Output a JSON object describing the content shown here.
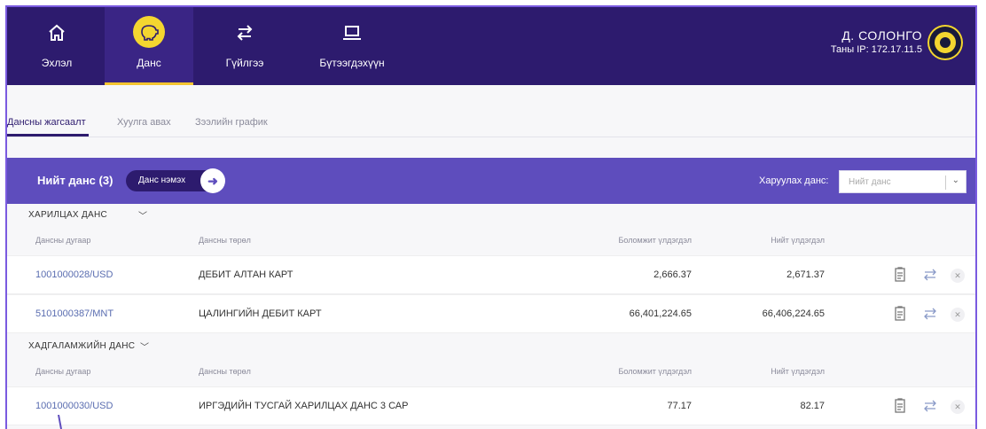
{
  "nav": {
    "items": [
      {
        "label": "Эхлэл",
        "icon": "home-icon"
      },
      {
        "label": "Данс",
        "icon": "piggy-bank-icon"
      },
      {
        "label": "Гүйлгээ",
        "icon": "transfer-icon"
      },
      {
        "label": "Бүтээгдэхүүн",
        "icon": "laptop-icon"
      }
    ],
    "active_index": 1,
    "accent": "#f4c430"
  },
  "user": {
    "name": "Д. СОЛОНГО",
    "ip": "Таны IP: 172.17.11.5"
  },
  "subtabs": [
    {
      "label": "Дансны жагсаалт",
      "active": true
    },
    {
      "label": "Хуулга авах",
      "active": false
    },
    {
      "label": "Зээлийн график",
      "active": false
    }
  ],
  "account_bar": {
    "total_label": "Нийт данс (3)",
    "add_label": "Данс нэмэх",
    "show_label": "Харуулах данс:",
    "select_placeholder": "Нийт данс",
    "color": "#5e4dbd"
  },
  "columns": {
    "account": "Дансны дугаар",
    "type": "Дансны төрөл",
    "available": "Боломжит үлдэгдэл",
    "total": "Нийт үлдэгдэл"
  },
  "sections": [
    {
      "title": "ХАРИЛЦАХ ДАНС",
      "rows": [
        {
          "account": "1001000028/USD",
          "type": "ДЕБИТ АЛТАН КАРТ",
          "available": "2,666.37",
          "total": "2,671.37"
        },
        {
          "account": "5101000387/MNT",
          "type": "ЦАЛИНГИЙН ДЕБИТ КАРТ",
          "available": "66,401,224.65",
          "total": "66,406,224.65"
        }
      ]
    },
    {
      "title": "ХАДГАЛАМЖИЙН ДАНС",
      "rows": [
        {
          "account": "1001000030/USD",
          "type": "ИРГЭДИЙН ТУСГАЙ ХАРИЛЦАХ ДАНС 3 САР",
          "available": "77.17",
          "total": "82.17"
        }
      ]
    }
  ]
}
